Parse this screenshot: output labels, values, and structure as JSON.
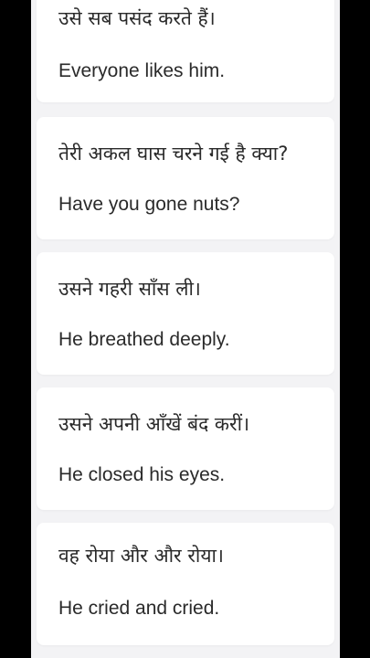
{
  "phrases": [
    {
      "hindi": "उसे सब पसंद करते हैं।",
      "english": "Everyone likes him."
    },
    {
      "hindi": "तेरी अकल घास चरने गई है क्या?",
      "english": "Have you gone nuts?"
    },
    {
      "hindi": "उसने गहरी साँस ली।",
      "english": "He breathed deeply."
    },
    {
      "hindi": "उसने अपनी आँखें बंद करीं।",
      "english": "He closed his eyes."
    },
    {
      "hindi": "वह रोया और और रोया।",
      "english": "He cried and cried."
    }
  ]
}
